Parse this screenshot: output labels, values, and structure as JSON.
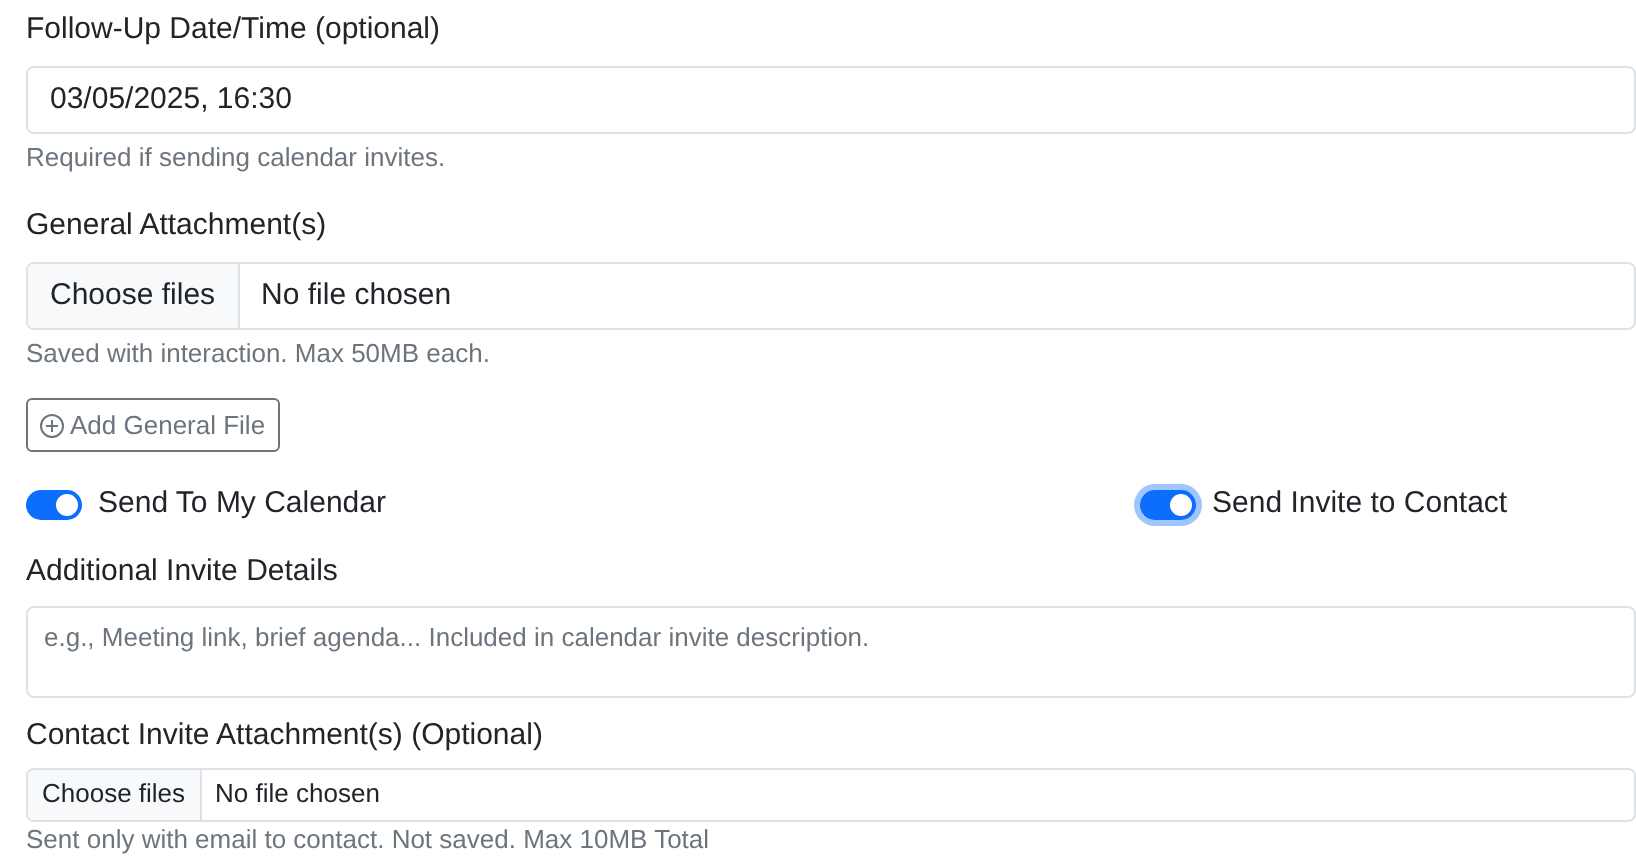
{
  "follow_up": {
    "label": "Follow-Up Date/Time (optional)",
    "value": "03/05/2025, 16:30",
    "help": "Required if sending calendar invites."
  },
  "general_attachments": {
    "label": "General Attachment(s)",
    "button": "Choose files",
    "status": "No file chosen",
    "help": "Saved with interaction. Max 50MB each.",
    "add_button": "Add General File"
  },
  "toggles": [
    {
      "label": "Send To My Calendar",
      "on": true,
      "focused": false
    },
    {
      "label": "Send Invite to Contact",
      "on": true,
      "focused": true
    }
  ],
  "invite_details": {
    "label": "Additional Invite Details",
    "placeholder": "e.g., Meeting link, brief agenda... Included in calendar invite description."
  },
  "contact_attachments": {
    "label": "Contact Invite Attachment(s) (Optional)",
    "button": "Choose files",
    "status": "No file chosen",
    "help": "Sent only with email to contact. Not saved. Max 10MB Total"
  }
}
